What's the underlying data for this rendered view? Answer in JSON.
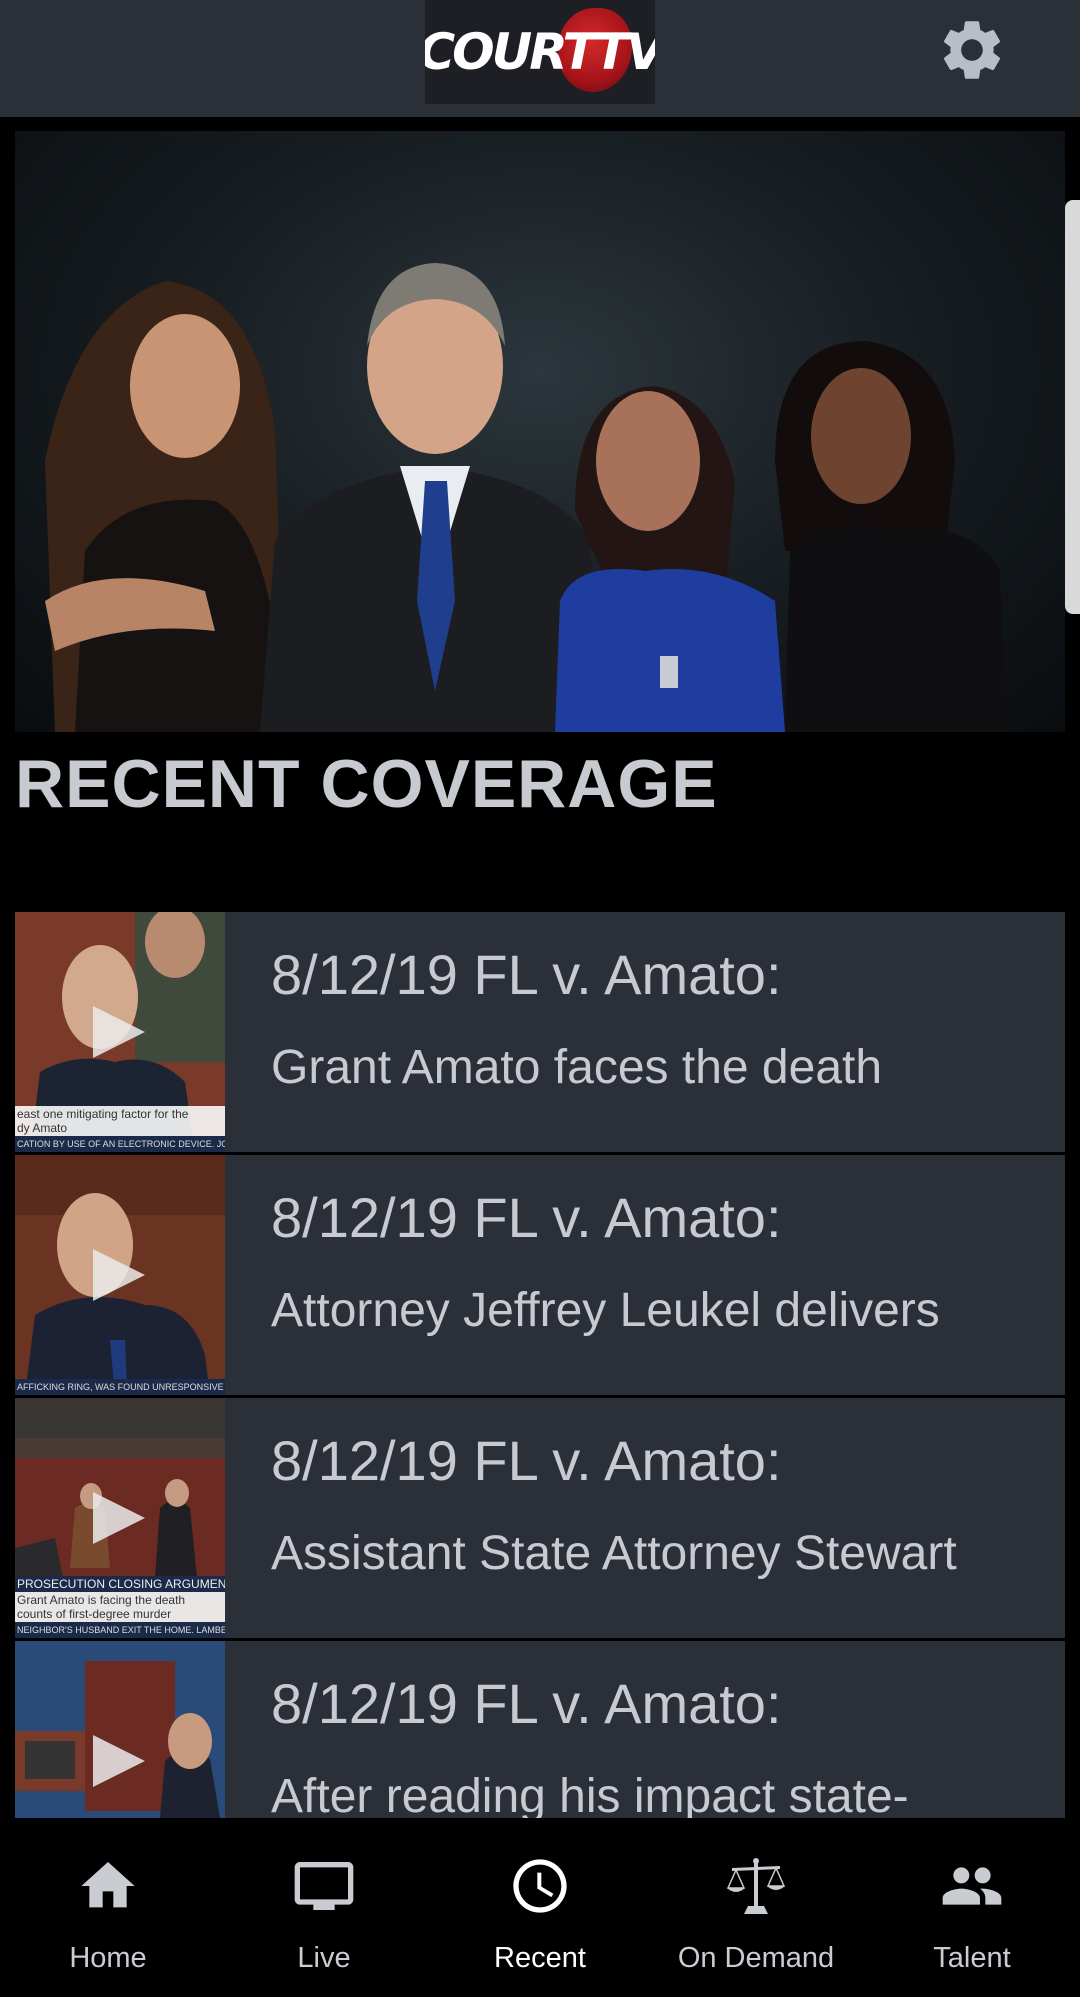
{
  "header": {
    "logo_text": "COURTTV",
    "settings_icon": "gear-icon"
  },
  "hero": {
    "image": "anchors-group-photo"
  },
  "section_title": "RECENT COVERAGE",
  "videos": [
    {
      "line1": "8/12/19 FL v. Amato:",
      "line2": "Grant Amato faces the death",
      "thumb_caption": "east one mitigating factor for the",
      "thumb_caption2": "dy Amato",
      "thumb_strip": "CATION BY USE OF AN ELECTRONIC DEVICE. JOHNSON WAS"
    },
    {
      "line1": "8/12/19 FL v. Amato:",
      "line2": "Attorney Jeffrey Leukel delivers",
      "thumb_strip": "AFFICKING RING, WAS FOUND UNRESPONSIVE IN HIS CELL SA"
    },
    {
      "line1": "8/12/19 FL v. Amato:",
      "line2": "Assistant State Attorney Stewart",
      "thumb_title": "PROSECUTION CLOSING ARGUMENT",
      "thumb_caption": "Grant Amato is facing the death",
      "thumb_caption2": "counts of first-degree murder",
      "thumb_strip": "NEIGHBOR'S HUSBAND EXIT THE HOME. LAMBERT PURCHAS"
    },
    {
      "line1": "8/12/19 FL v. Amato:",
      "line2": "After reading his impact state-"
    }
  ],
  "tabs": [
    {
      "label": "Home",
      "icon": "home-icon"
    },
    {
      "label": "Live",
      "icon": "tv-icon"
    },
    {
      "label": "Recent",
      "icon": "clock-icon",
      "active": true
    },
    {
      "label": "On Demand",
      "icon": "scales-icon"
    },
    {
      "label": "Talent",
      "icon": "people-icon"
    }
  ],
  "colors": {
    "topbar": "#2b2f37",
    "item_bg": "#2b2f37",
    "text": "#c7cbd1",
    "background": "#000000",
    "logo_red": "#c41e24"
  }
}
